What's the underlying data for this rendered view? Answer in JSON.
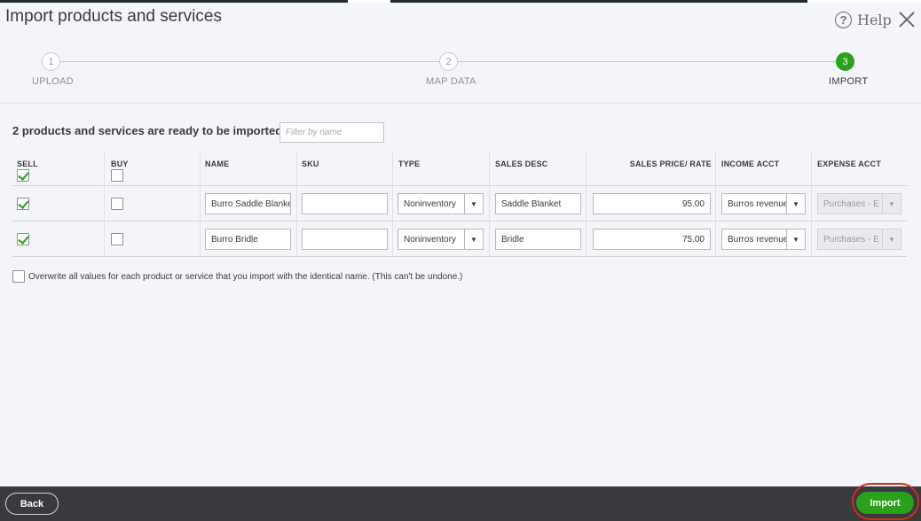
{
  "window": {
    "title": "Import products and services",
    "help_label": "Help"
  },
  "stepper": {
    "steps": [
      {
        "number": "1",
        "label": "UPLOAD"
      },
      {
        "number": "2",
        "label": "MAP DATA"
      },
      {
        "number": "3",
        "label": "IMPORT"
      }
    ],
    "active_step": 3
  },
  "summary": {
    "heading": "2 products and services are ready to be imported",
    "filter_placeholder": "Filter by name"
  },
  "table": {
    "headers": {
      "sell": "SELL",
      "buy": "BUY",
      "name": "NAME",
      "sku": "SKU",
      "type": "TYPE",
      "sales_desc": "SALES DESC",
      "sales_price": "SALES PRICE/ RATE",
      "income_acct": "INCOME ACCT",
      "expense_acct": "EXPENSE ACCT"
    },
    "select_all_sell": true,
    "select_all_buy": false,
    "rows": [
      {
        "sell": true,
        "buy": false,
        "name": "Burro Saddle Blanket",
        "sku": "",
        "type": "Noninventory",
        "sales_desc": "Saddle Blanket",
        "sales_price": "95.00",
        "income_acct": "Burros revenue",
        "expense_acct": "Purchases - E"
      },
      {
        "sell": true,
        "buy": false,
        "name": "Burro Bridle",
        "sku": "",
        "type": "Noninventory",
        "sales_desc": "Bridle",
        "sales_price": "75.00",
        "income_acct": "Burros revenue",
        "expense_acct": "Purchases - E"
      }
    ]
  },
  "overwrite": {
    "checked": false,
    "label": "Overwrite all values for each product or service that you import with the identical name. (This can't be undone.)"
  },
  "footer": {
    "back_label": "Back",
    "import_label": "Import"
  },
  "colors": {
    "accent_green": "#2ca01c",
    "footer_bg": "#393a3d",
    "highlight_ring": "#d52b1e"
  },
  "icons": {
    "help": "help-circle-icon",
    "close": "close-icon",
    "dropdown": "caret-down-icon"
  }
}
